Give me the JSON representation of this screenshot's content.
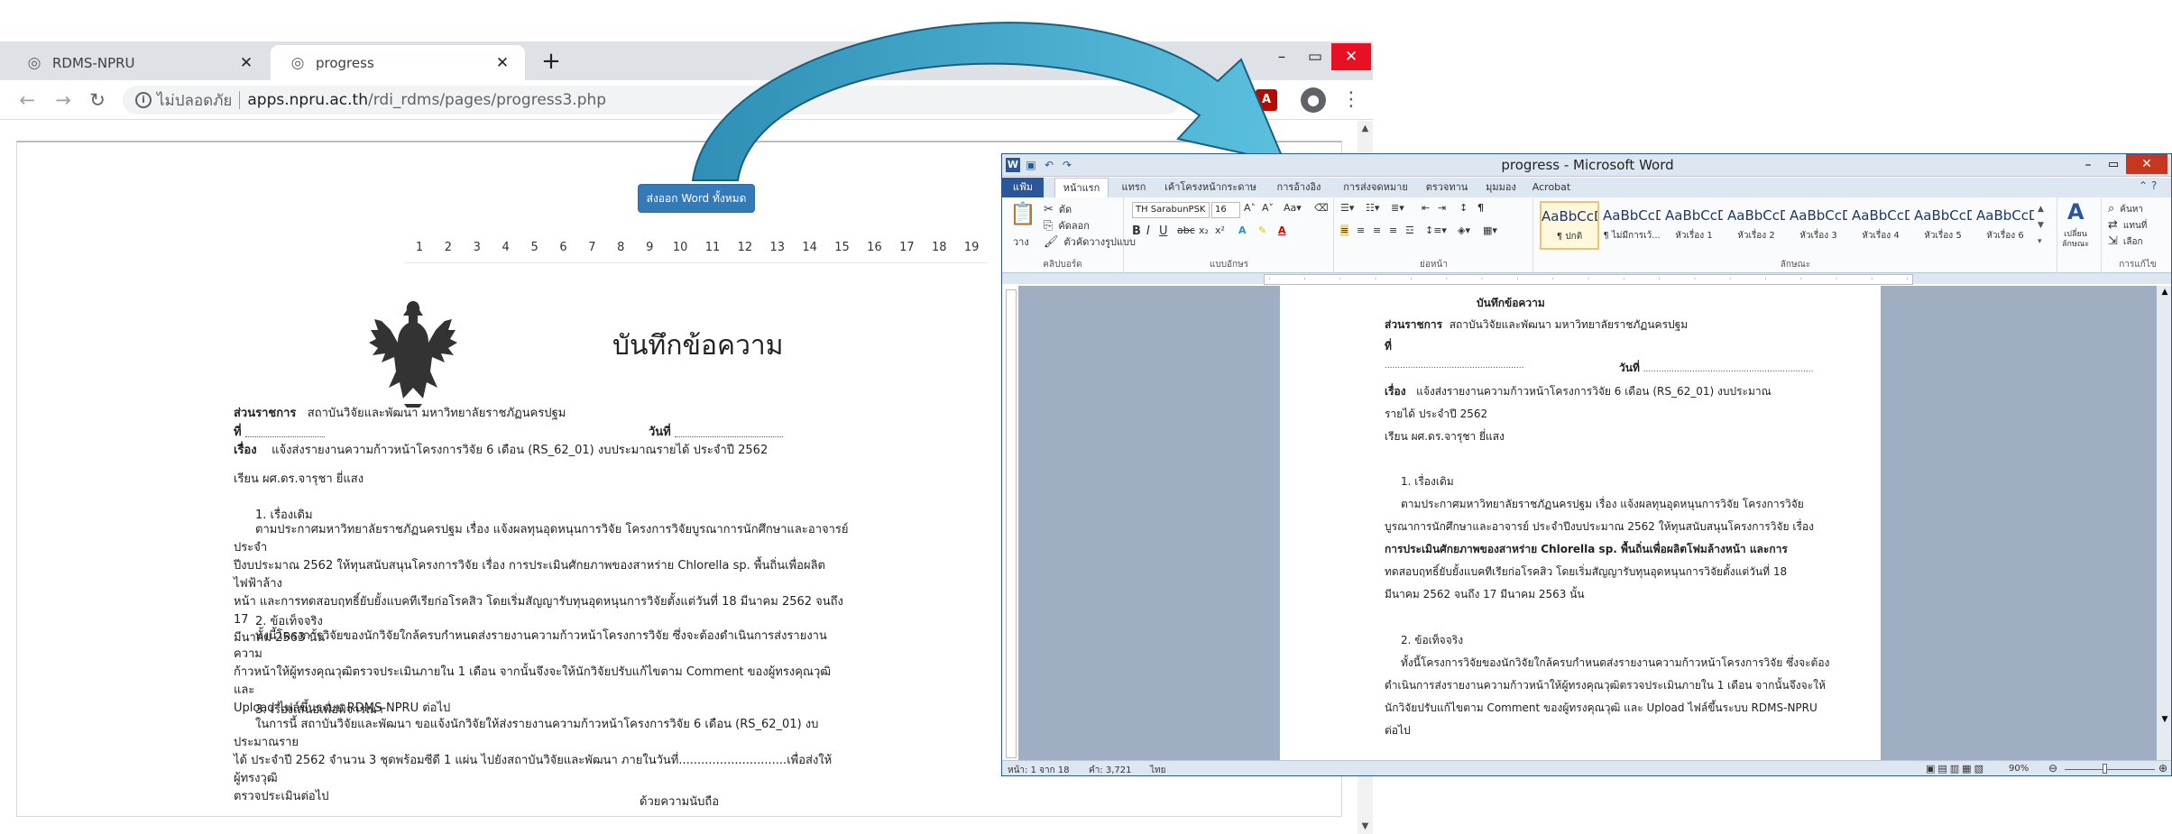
{
  "browser": {
    "tabs": [
      {
        "title": "RDMS-NPRU",
        "icon": "globe-icon"
      },
      {
        "title": "progress",
        "icon": "globe-icon"
      }
    ],
    "window_controls": {
      "minimize": "–",
      "maximize": "▭",
      "close": "✕"
    },
    "omnibox": {
      "insecure_label": "ไม่ปลอดภัย",
      "domain": "apps.npru.ac.th",
      "path": "/rdi_rdms/pages/progress3.php"
    }
  },
  "webpage": {
    "export_button": "ส่งออก Word ทั้งหมด",
    "pages": [
      "1",
      "2",
      "3",
      "4",
      "5",
      "6",
      "7",
      "8",
      "9",
      "10",
      "11",
      "12",
      "13",
      "14",
      "15",
      "16",
      "17",
      "18",
      "19"
    ],
    "memo_title": "บันทึกข้อความ",
    "agency_label": "ส่วนราชการ",
    "agency_value": "สถาบันวิจัยและพัฒนา  มหาวิทยาลัยราชภัฏนครปฐม",
    "ref_label": "ที่",
    "date_label": "วันที่",
    "subject_label": "เรื่อง",
    "subject_value": "แจ้งส่งรายงานความก้าวหน้าโครงการวิจัย 6 เดือน (RS_62_01) งบประมาณรายได้ ประจำปี 2562",
    "salutation": "เรียน ผศ.ดร.จารุชา ยี่แสง",
    "s1_heading": "1. เรื่องเดิม",
    "s1_lines": [
      "ตามประกาศมหาวิทยาลัยราชภัฏนครปฐม เรื่อง แจ้งผลทุนอุดหนุนการวิจัย โครงการวิจัยบูรณาการนักศึกษาและอาจารย์ ประจำ",
      "ปีงบประมาณ 2562 ให้ทุนสนับสนุนโครงการวิจัย เรื่อง การประเมินศักยภาพของสาหร่าย Chlorella sp. พื้นถิ่นเพื่อผลิตไฟฟ้าล้าง",
      "หน้า และการทดสอบฤทธิ์ยับยั้งแบคทีเรียก่อโรคสิว โดยเริ่มสัญญารับทุนอุดหนุนการวิจัยตั้งแต่วันที่ 18 มีนาคม 2562 จนถึง 17",
      "มีนาคม 2563 นั้น"
    ],
    "s2_heading": "2. ข้อเท็จจริง",
    "s2_lines": [
      "ทั้งนี้โครงการวิจัยของนักวิจัยใกล้ครบกำหนดส่งรายงานความก้าวหน้าโครงการวิจัย ซึ่งจะต้องดำเนินการส่งรายงานความ",
      "ก้าวหน้าให้ผู้ทรงคุณวุฒิตรวจประเมินภายใน 1 เดือน จากนั้นจึงจะให้นักวิจัยปรับแก้ไขตาม Comment ของผู้ทรงคุณวุฒิ และ",
      "Upload ไฟล์ขึ้นระบบ RDMS-NPRU ต่อไป"
    ],
    "s3_heading": "3. เรื่องเสนอเพื่อพิจารณา",
    "s3_lines": [
      "ในการนี้ สถาบันวิจัยและพัฒนา ขอแจ้งนักวิจัยให้ส่งรายงานความก้าวหน้าโครงการวิจัย 6 เดือน (RS_62_01) งบประมาณราย",
      "ได้ ประจำปี 2562 จำนวน 3 ชุดพร้อมซีดี 1 แผ่น ไปยังสถาบันวิจัยและพัฒนา ภายในวันที่.............................เพื่อส่งให้ผู้ทรงวุฒิ",
      "ตรวจประเมินต่อไป"
    ],
    "closing": "ด้วยความนับถือ"
  },
  "word": {
    "title": "progress - Microsoft Word",
    "tabs": [
      "แฟ้ม",
      "หน้าแรก",
      "แทรก",
      "เค้าโครงหน้ากระดาษ",
      "การอ้างอิง",
      "การส่งจดหมาย",
      "ตรวจทาน",
      "มุมมอง",
      "Acrobat"
    ],
    "clipboard": {
      "paste": "วาง",
      "cut": "ตัด",
      "copy": "คัดลอก",
      "format_painter": "ตัวคัดวางรูปแบบ",
      "label": "คลิปบอร์ด"
    },
    "font": {
      "name": "TH SarabunPSK",
      "size": "16",
      "label": "แบบอักษร"
    },
    "paragraph_label": "ย่อหน้า",
    "styles": [
      {
        "sample": "AaBbCcDc",
        "name": "¶ ปกติ"
      },
      {
        "sample": "AaBbCcDc",
        "name": "¶ ไม่มีการเว้..."
      },
      {
        "sample": "AaBbCcD",
        "name": "หัวเรื่อง 1"
      },
      {
        "sample": "AaBbCcD",
        "name": "หัวเรื่อง 2"
      },
      {
        "sample": "AaBbCcD",
        "name": "หัวเรื่อง 3"
      },
      {
        "sample": "AaBbCcD",
        "name": "หัวเรื่อง 4"
      },
      {
        "sample": "AaBbCcD",
        "name": "หัวเรื่อง 5"
      },
      {
        "sample": "AaBbCcD",
        "name": "หัวเรื่อง 6"
      }
    ],
    "styles_label": "ลักษณะ",
    "change_styles": "เปลี่ยน\nลักษณะ",
    "editing": {
      "find": "ค้นหา",
      "replace": "แทนที่",
      "select": "เลือก",
      "label": "การแก้ไข"
    },
    "doc": {
      "title": "บันทึกข้อความ",
      "agency_label": "ส่วนราชการ",
      "agency_value": "สถาบันวิจัยและพัฒนา  มหาวิทยาลัยราชภัฏนครปฐม",
      "ref_label": "ที่",
      "dots_left": "......................................................",
      "date_label": "วันที่",
      "dots_right": "..................................................................",
      "subject_label": "เรื่อง",
      "subject_value": "แจ้งส่งรายงานความก้าวหน้าโครงการวิจัย 6 เดือน (RS_62_01) งบประมาณ",
      "subject_cont": "รายได้ ประจำปี 2562",
      "salutation": "เรียน ผศ.ดร.จารุชา ยี่แสง",
      "s1_heading": "1. เรื่องเดิม",
      "s1_lines": [
        "ตามประกาศมหาวิทยาลัยราชภัฏนครปฐม เรื่อง แจ้งผลทุนอุดหนุนการวิจัย โครงการวิจัย",
        "บูรณาการนักศึกษาและอาจารย์ ประจำปีงบประมาณ 2562 ให้ทุนสนับสนุนโครงการวิจัย เรื่อง",
        "การประเมินศักยภาพของสาหร่าย Chlorella sp. พื้นถิ่นเพื่อผลิตโฟมล้างหน้า และการ",
        "ทดสอบฤทธิ์ยับยั้งแบคทีเรียก่อโรคสิว โดยเริ่มสัญญารับทุนอุดหนุนการวิจัยตั้งแต่วันที่ 18",
        "มีนาคม 2562 จนถึง 17 มีนาคม 2563 นั้น"
      ],
      "s2_heading": "2. ข้อเท็จจริง",
      "s2_lines": [
        "ทั้งนี้โครงการวิจัยของนักวิจัยใกล้ครบกำหนดส่งรายงานความก้าวหน้าโครงการวิจัย ซึ่งจะต้อง",
        "ดำเนินการส่งรายงานความก้าวหน้าให้ผู้ทรงคุณวุฒิตรวจประเมินภายใน 1 เดือน จากนั้นจึงจะให้",
        "นักวิจัยปรับแก้ไขตาม Comment ของผู้ทรงคุณวุฒิ และ Upload ไฟล์ขึ้นระบบ RDMS-NPRU",
        "ต่อไป"
      ]
    },
    "status": {
      "page": "หน้า: 1 จาก 18",
      "words": "คำ: 3,721",
      "lang": "ไทย",
      "zoom": "90%"
    }
  }
}
